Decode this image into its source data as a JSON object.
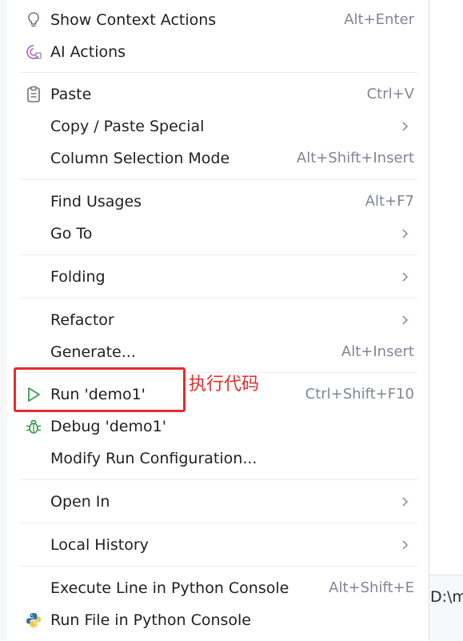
{
  "background": {
    "peek_text": "D:\\m"
  },
  "menu": {
    "items": [
      {
        "label": "Show Context Actions",
        "shortcut": "Alt+Enter",
        "icon": "lightbulb-icon"
      },
      {
        "label": "AI Actions",
        "shortcut": "",
        "icon": "ai-assistant-icon"
      },
      {
        "label": "Paste",
        "shortcut": "Ctrl+V",
        "icon": "clipboard-icon"
      },
      {
        "label": "Copy / Paste Special",
        "shortcut": "",
        "submenu": true
      },
      {
        "label": "Column Selection Mode",
        "shortcut": "Alt+Shift+Insert"
      },
      {
        "label": "Find Usages",
        "shortcut": "Alt+F7"
      },
      {
        "label": "Go To",
        "shortcut": "",
        "submenu": true
      },
      {
        "label": "Folding",
        "shortcut": "",
        "submenu": true
      },
      {
        "label": "Refactor",
        "shortcut": "",
        "submenu": true
      },
      {
        "label": "Generate...",
        "shortcut": "Alt+Insert"
      },
      {
        "label": "Run 'demo1'",
        "shortcut": "Ctrl+Shift+F10",
        "icon": "run-play-icon"
      },
      {
        "label": "Debug 'demo1'",
        "shortcut": "",
        "icon": "debug-bug-icon"
      },
      {
        "label": "Modify Run Configuration...",
        "shortcut": ""
      },
      {
        "label": "Open In",
        "shortcut": "",
        "submenu": true
      },
      {
        "label": "Local History",
        "shortcut": "",
        "submenu": true
      },
      {
        "label": "Execute Line in Python Console",
        "shortcut": "Alt+Shift+E"
      },
      {
        "label": "Run File in Python Console",
        "shortcut": "",
        "icon": "python-icon"
      }
    ]
  },
  "annotation": {
    "text": "执行代码",
    "color": "#e82b2b"
  },
  "colors": {
    "run_icon": "#3d9a50",
    "debug_icon": "#3d9a50",
    "python_blue": "#3572a5",
    "python_yellow": "#f2c94c"
  }
}
